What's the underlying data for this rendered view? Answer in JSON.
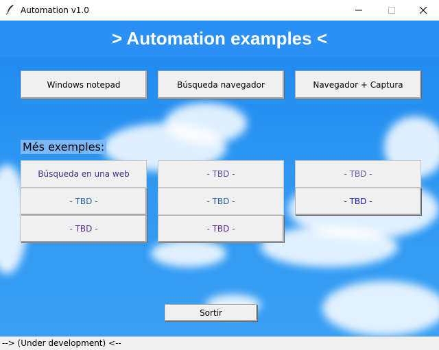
{
  "window": {
    "title": "Automation v1.0"
  },
  "header": {
    "title": "> Automation examples <"
  },
  "main_buttons": [
    {
      "label": "Windows notepad"
    },
    {
      "label": "Búsqueda navegador"
    },
    {
      "label": "Navegador + Captura"
    }
  ],
  "more_section": {
    "label": "Més exemples:",
    "buttons": [
      {
        "label": "Búsqueda en una web",
        "color": "#3d2f8f"
      },
      {
        "label": "- TBD -",
        "color": "#5a4aa8"
      },
      {
        "label": "- TBD -",
        "color": "#6a5ab0"
      },
      {
        "label": "- TBD -",
        "color": "#1f5fa0"
      },
      {
        "label": "- TBD -",
        "color": "#1f5fa0"
      },
      {
        "label": "- TBD -",
        "color": "#1a1aa0"
      },
      {
        "label": "- TBD -",
        "color": "#5a2a9a"
      },
      {
        "label": "- TBD -",
        "color": "#5a2a9a"
      }
    ]
  },
  "exit_button": {
    "label": "Sortir"
  },
  "status": {
    "text": "--> (Under development) <--"
  },
  "colors": {
    "header_bg": "#2a8ff7",
    "sky": "#2a95f2"
  }
}
